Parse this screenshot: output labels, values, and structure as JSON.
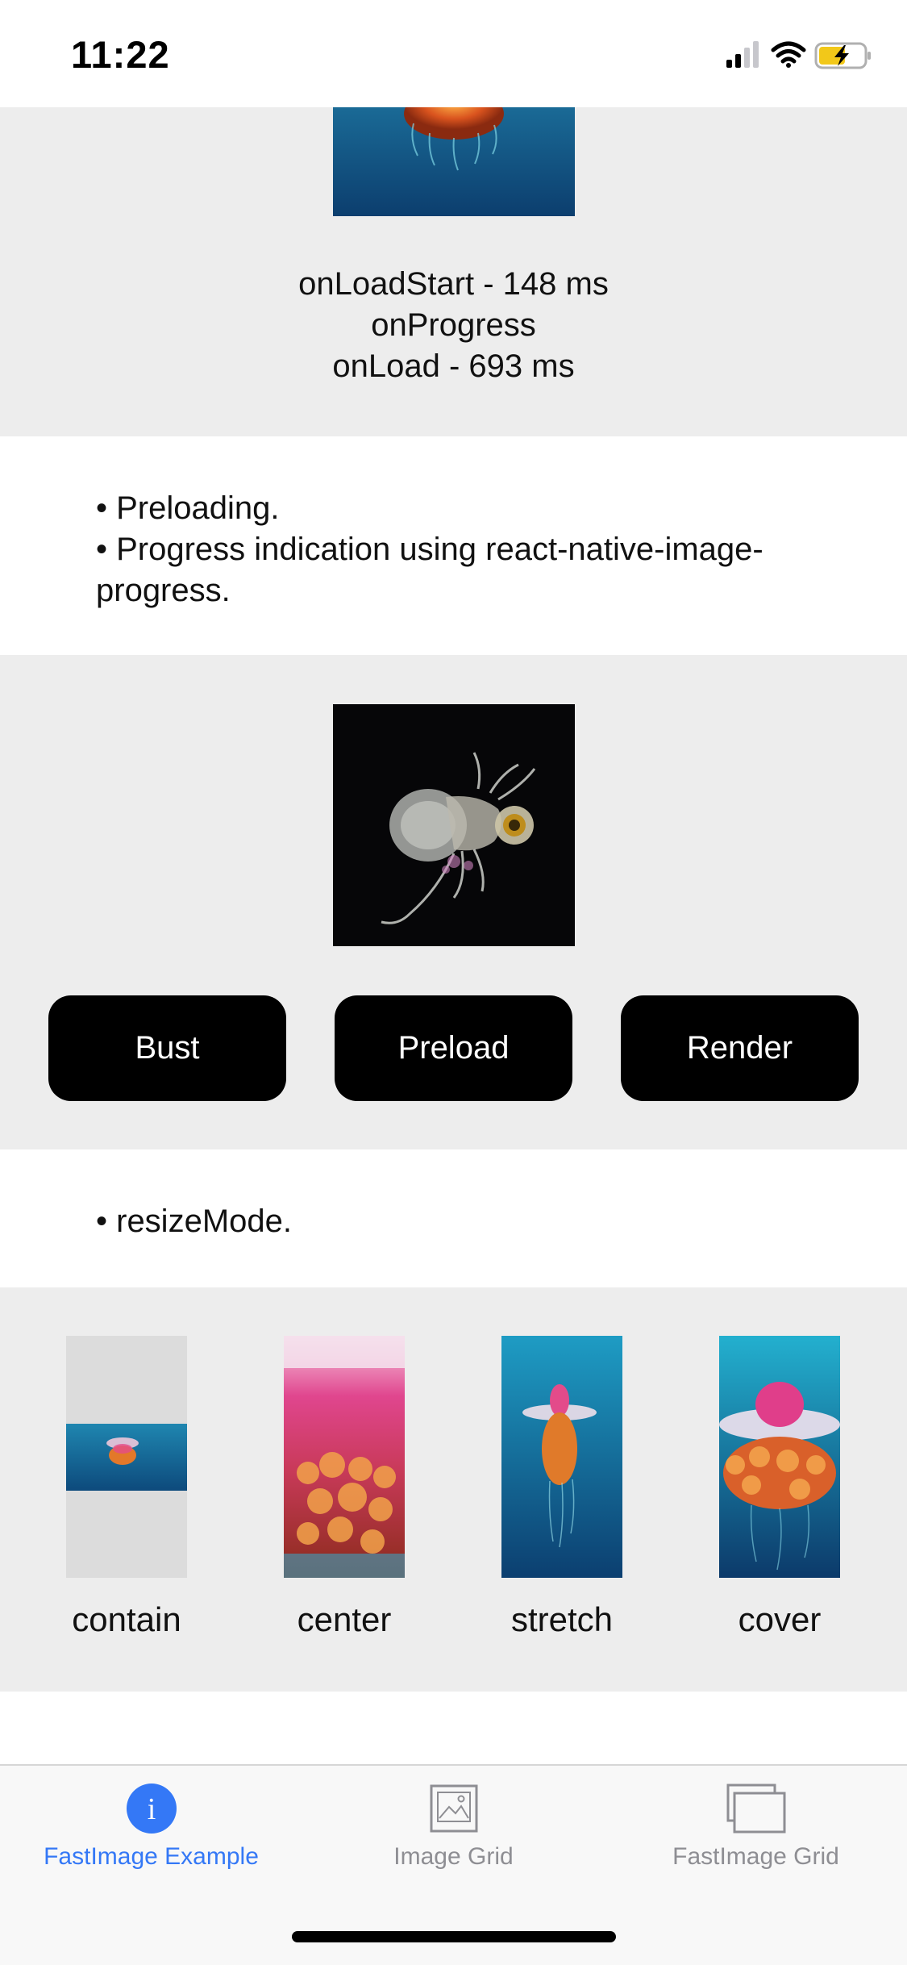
{
  "status_bar": {
    "time": "11:22",
    "icons": [
      "cellular-signal-icon",
      "wifi-icon",
      "battery-charging-icon"
    ]
  },
  "timing": {
    "lines": [
      "onLoadStart - 148 ms",
      "onProgress",
      "onLoad - 693 ms"
    ]
  },
  "features": {
    "lines": [
      "• Preloading.",
      "• Progress indication using react-native-image-progress."
    ]
  },
  "preload": {
    "buttons": [
      {
        "label": "Bust"
      },
      {
        "label": "Preload"
      },
      {
        "label": "Render"
      }
    ]
  },
  "resize": {
    "title": "• resizeMode.",
    "modes": [
      {
        "label": "contain"
      },
      {
        "label": "center"
      },
      {
        "label": "stretch"
      },
      {
        "label": "cover"
      }
    ]
  },
  "tab_bar": {
    "tabs": [
      {
        "label": "FastImage Example",
        "icon": "info-icon",
        "active": true
      },
      {
        "label": "Image Grid",
        "icon": "image-icon",
        "active": false
      },
      {
        "label": "FastImage Grid",
        "icon": "stacked-images-icon",
        "active": false
      }
    ]
  },
  "colors": {
    "accent": "#3478f6",
    "section_gray": "#ededed",
    "button_bg": "#000000",
    "inactive_tab": "#8e8e93"
  }
}
